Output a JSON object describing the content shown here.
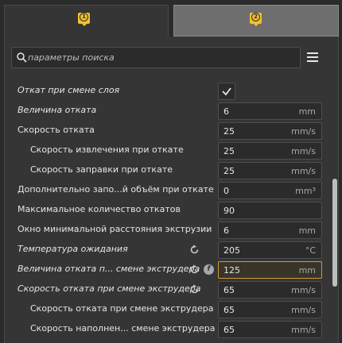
{
  "tabs": [
    {
      "number": "1"
    },
    {
      "number": "2"
    }
  ],
  "search": {
    "placeholder": "параметры поиска"
  },
  "settings": [
    {
      "label": "Откат при смене слоя",
      "italic": true,
      "indent": 0,
      "type": "checkbox",
      "checked": true
    },
    {
      "label": "Величина отката",
      "italic": true,
      "indent": 0,
      "value": "6",
      "unit": "mm"
    },
    {
      "label": "Скорость отката",
      "italic": false,
      "indent": 0,
      "value": "25",
      "unit": "mm/s"
    },
    {
      "label": "Скорость извлечения при откате",
      "italic": false,
      "indent": 1,
      "value": "25",
      "unit": "mm/s"
    },
    {
      "label": "Скорость заправки при откате",
      "italic": false,
      "indent": 1,
      "value": "25",
      "unit": "mm/s"
    },
    {
      "label": "Дополнительно запо...й объём при откате",
      "italic": false,
      "indent": 0,
      "value": "0",
      "unit": "mm³"
    },
    {
      "label": "Максимальное количество откатов",
      "italic": false,
      "indent": 0,
      "value": "90",
      "unit": ""
    },
    {
      "label": "Окно минимальной расстояния экструзии",
      "italic": false,
      "indent": 0,
      "value": "6",
      "unit": "mm"
    },
    {
      "label": "Температура ожидания",
      "italic": true,
      "indent": 0,
      "value": "205",
      "unit": "°C",
      "reset": true
    },
    {
      "label": "Величина отката п... смене экструдера",
      "italic": true,
      "indent": 0,
      "value": "125",
      "unit": "mm",
      "reset": true,
      "func": true,
      "active": true
    },
    {
      "label": "Скорость отката при смене экструдера",
      "italic": true,
      "indent": 0,
      "value": "65",
      "unit": "mm/s",
      "reset": true
    },
    {
      "label": "Скорость отката при смене экструдера",
      "italic": false,
      "indent": 1,
      "value": "65",
      "unit": "mm/s"
    },
    {
      "label": "Скорость наполнен... смене экструдера",
      "italic": false,
      "indent": 1,
      "value": "65",
      "unit": "mm/s"
    }
  ],
  "colors": {
    "accent": "#f2c12e",
    "active_border": "#d69a31",
    "background": "#353535"
  }
}
